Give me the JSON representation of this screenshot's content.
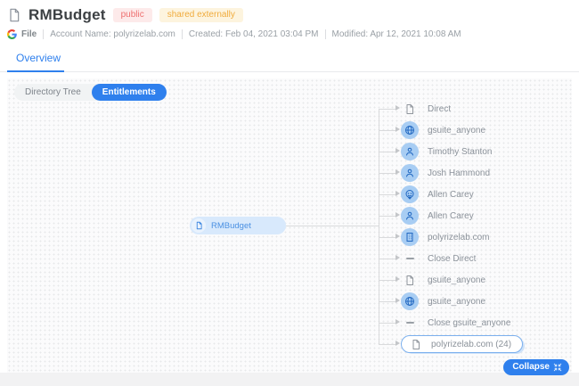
{
  "header": {
    "title": "RMBudget",
    "badges": [
      {
        "label": "public",
        "bg": "#fdeaea",
        "color": "#ee7070"
      },
      {
        "label": "shared externally",
        "bg": "#fdf4de",
        "color": "#f0ab3c"
      }
    ],
    "meta": {
      "file_label": "File",
      "account": "Account Name: polyrizelab.com",
      "created": "Created: Feb 04, 2021 03:04 PM",
      "modified": "Modified: Apr 12, 2021 10:08 AM"
    }
  },
  "tabs": [
    {
      "label": "Overview",
      "active": true
    }
  ],
  "toolbar": {
    "toggle": [
      {
        "label": "Directory Tree",
        "active": false
      },
      {
        "label": "Entitlements",
        "active": true
      }
    ]
  },
  "tree": {
    "root": {
      "label": "RMBudget",
      "icon": "document"
    },
    "children": [
      {
        "label": "Direct",
        "icon": "document"
      },
      {
        "label": "gsuite_anyone",
        "icon": "globe",
        "circled": true
      },
      {
        "label": "Timothy Stanton",
        "icon": "user",
        "circled": true
      },
      {
        "label": "Josh Hammond",
        "icon": "user",
        "circled": true
      },
      {
        "label": "Allen Carey",
        "icon": "anonymous",
        "circled": true
      },
      {
        "label": "Allen Carey",
        "icon": "user",
        "circled": true
      },
      {
        "label": "polyrizelab.com",
        "icon": "organization",
        "circled": true
      },
      {
        "label": "Close Direct",
        "icon": "dash"
      },
      {
        "label": "gsuite_anyone",
        "icon": "document"
      },
      {
        "label": "gsuite_anyone",
        "icon": "globe",
        "circled": true
      },
      {
        "label": "Close gsuite_anyone",
        "icon": "dash"
      },
      {
        "label": "polyrizelab.com (24)",
        "icon": "document",
        "node": true
      }
    ]
  },
  "collapse_button": {
    "label": "Collapse"
  },
  "colors": {
    "accent": "#2f80ed",
    "node_fill": "#d8e9fc",
    "node_text": "#4a90e2",
    "icon_circle": "#a8cdf3",
    "connector": "#d9dadc",
    "label_gray": "#8b929a"
  }
}
